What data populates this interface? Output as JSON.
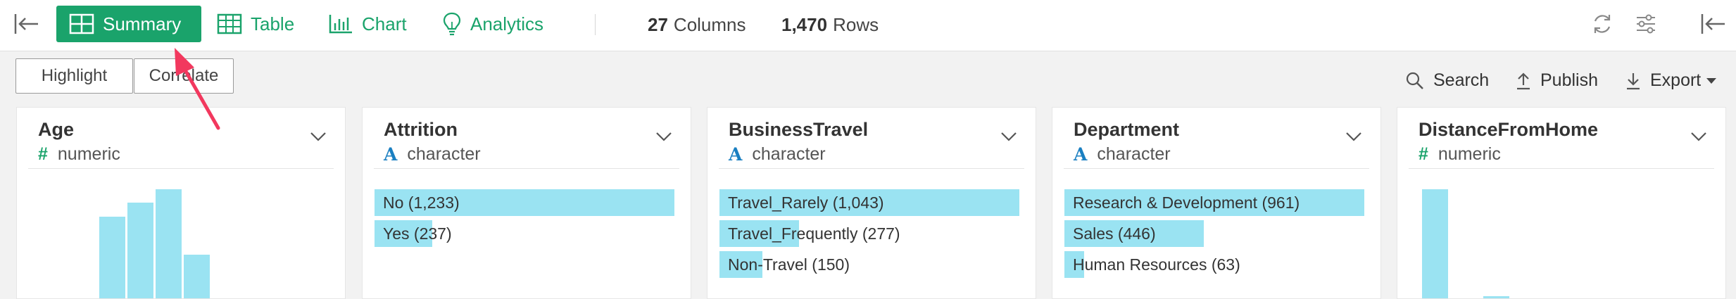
{
  "toolbar": {
    "views": [
      {
        "label": "Summary",
        "icon": "summary-grid-icon",
        "active": true
      },
      {
        "label": "Table",
        "icon": "table-icon",
        "active": false
      },
      {
        "label": "Chart",
        "icon": "chart-icon",
        "active": false
      },
      {
        "label": "Analytics",
        "icon": "lightbulb-icon",
        "active": false
      }
    ],
    "columns_count": "27",
    "columns_label": "Columns",
    "rows_count": "1,470",
    "rows_label": "Rows"
  },
  "actions": {
    "highlight": "Highlight",
    "correlate": "Correlate",
    "search": "Search",
    "publish": "Publish",
    "export": "Export"
  },
  "colors": {
    "accent": "#1aa36b",
    "bar": "#9ae3f2",
    "type_numeric": "#1aa36b",
    "type_character": "#1a7fc1",
    "annotation_arrow": "#f2385e"
  },
  "cards": [
    {
      "title": "Age",
      "type_symbol": "#",
      "type": "numeric",
      "histogram": [
        0.75,
        0.88,
        1.0,
        0.4
      ]
    },
    {
      "title": "Attrition",
      "type_symbol": "A",
      "type": "character",
      "bars": [
        {
          "label": "No (1,233)",
          "value": 1233
        },
        {
          "label": "Yes (237)",
          "value": 237
        }
      ]
    },
    {
      "title": "BusinessTravel",
      "type_symbol": "A",
      "type": "character",
      "bars": [
        {
          "label": "Travel_Rarely (1,043)",
          "value": 1043
        },
        {
          "label": "Travel_Frequently (277)",
          "value": 277
        },
        {
          "label": "Non-Travel (150)",
          "value": 150
        }
      ]
    },
    {
      "title": "Department",
      "type_symbol": "A",
      "type": "character",
      "bars": [
        {
          "label": "Research & Development (961)",
          "value": 961
        },
        {
          "label": "Sales (446)",
          "value": 446
        },
        {
          "label": "Human Resources (63)",
          "value": 63
        }
      ]
    },
    {
      "title": "DistanceFromHome",
      "type_symbol": "#",
      "type": "numeric",
      "histogram": [
        1.0,
        0.02
      ]
    }
  ]
}
